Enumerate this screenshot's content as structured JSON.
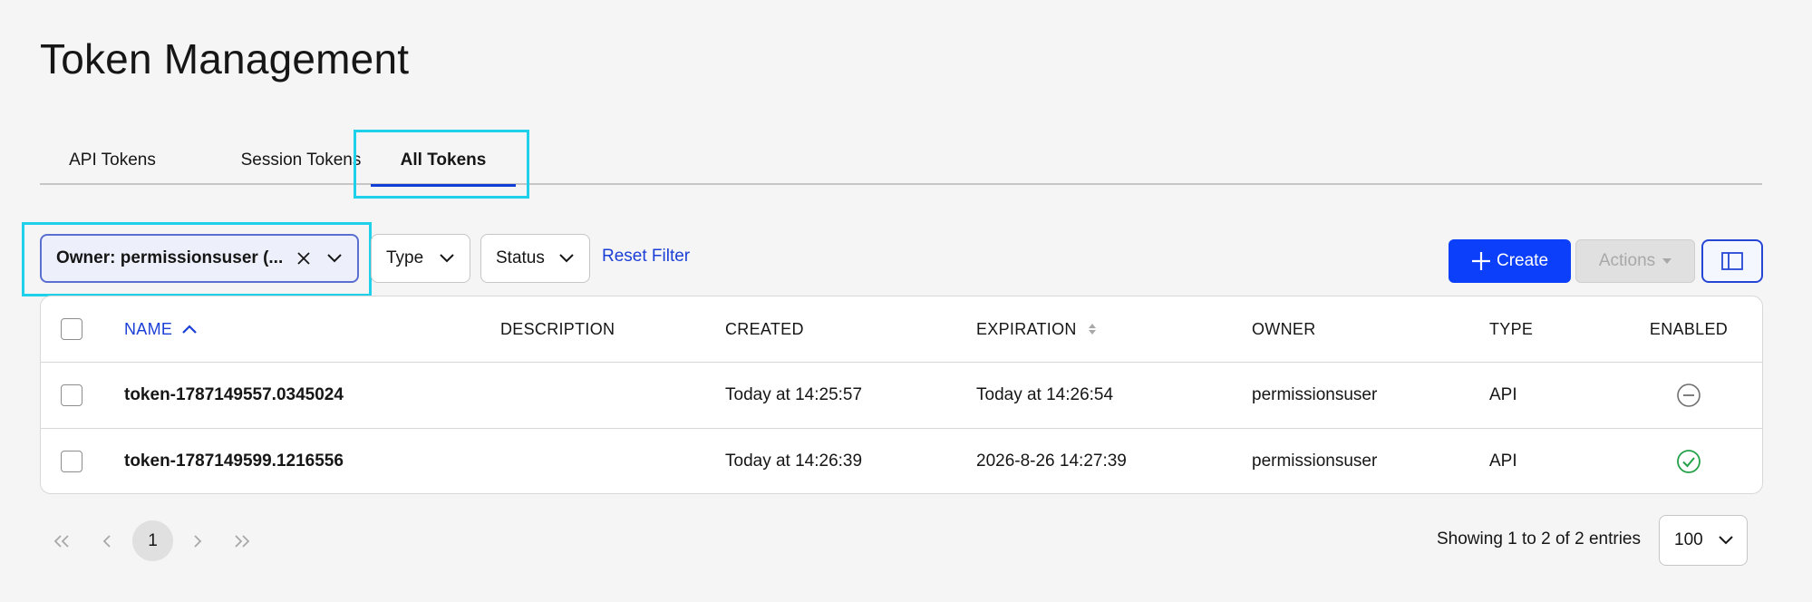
{
  "page": {
    "title": "Token Management"
  },
  "tabs": [
    {
      "label": "API Tokens"
    },
    {
      "label": "Session Tokens"
    },
    {
      "label": "All Tokens",
      "active": true
    }
  ],
  "filters": {
    "owner": "Owner: permissionsuser (...",
    "type": "Type",
    "status": "Status",
    "reset": "Reset Filter"
  },
  "toolbar": {
    "create": "Create",
    "actions": "Actions"
  },
  "table": {
    "headers": {
      "name": "NAME",
      "description": "DESCRIPTION",
      "created": "CREATED",
      "expiration": "EXPIRATION",
      "owner": "OWNER",
      "type": "TYPE",
      "enabled": "ENABLED"
    },
    "rows": [
      {
        "name": "token-1787149557.0345024",
        "description": "",
        "created": "Today at 14:25:57",
        "expiration": "Today at 14:26:54",
        "owner": "permissionsuser",
        "type": "API",
        "enabled": "disabled-icon"
      },
      {
        "name": "token-1787149599.1216556",
        "description": "",
        "created": "Today at 14:26:39",
        "expiration": "2026-8-26 14:27:39",
        "owner": "permissionsuser",
        "type": "API",
        "enabled": "check-circle-icon"
      }
    ]
  },
  "pagination": {
    "current_page": "1",
    "summary": "Showing 1 to 2 of 2 entries",
    "page_size": "100"
  },
  "colors": {
    "accent": "#0b3ffa",
    "link": "#1b3fd6",
    "highlight": "#1fd0ea",
    "success": "#24a148"
  }
}
